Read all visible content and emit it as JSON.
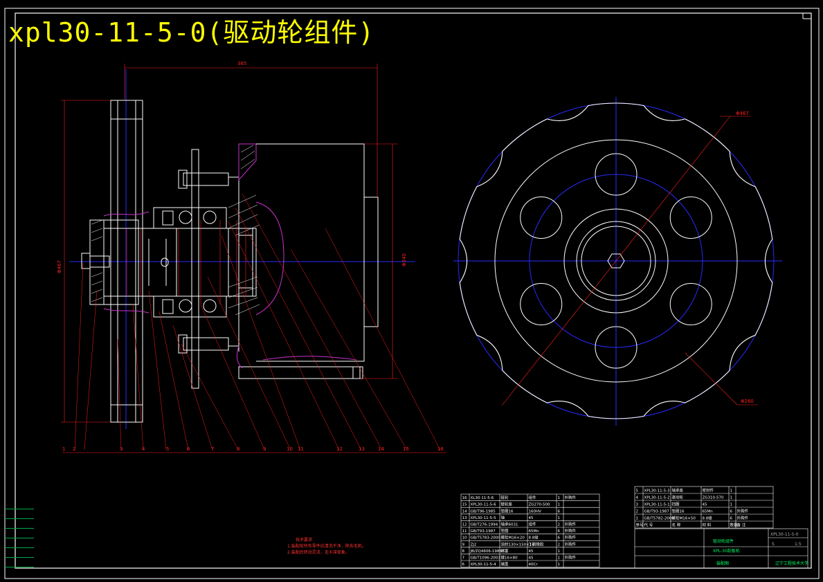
{
  "drawing": {
    "title": "xpl30-11-5-0(驱动轮组件)",
    "dimensions": {
      "overall_width": "365",
      "diameter_left": "Φ467",
      "diameter_right": "Φ340",
      "wheel_outer": "Φ467",
      "pitch_circle": "Φ260"
    },
    "balloons": [
      "1",
      "2",
      "3",
      "4",
      "5",
      "6",
      "7",
      "8",
      "9",
      "10",
      "11",
      "12",
      "13",
      "14",
      "15",
      "16"
    ],
    "tech_notes": [
      "技术要求",
      "1.装配前所有零件应清洗干净，除去毛刺。",
      "2.装配后转动灵活，无卡滞现象。"
    ],
    "left_strip": [
      "",
      "",
      "",
      "",
      "",
      "",
      "",
      "",
      ""
    ]
  },
  "bom_left": [
    {
      "no": "16",
      "code": "XL30-11-5-6",
      "name": "链轮",
      "qty": "1",
      "material": "组件",
      "note": "外购件"
    },
    {
      "no": "15",
      "code": "XPL30-11-5-6",
      "name": "链轮座",
      "qty": "1",
      "material": "ZG270-500",
      "note": ""
    },
    {
      "no": "14",
      "code": "GB/T96-1985",
      "name": "垫圈16",
      "qty": "6",
      "material": "160HV",
      "note": ""
    },
    {
      "no": "13",
      "code": "XPL30-11-5-5",
      "name": "轴",
      "qty": "1",
      "material": "45",
      "note": ""
    },
    {
      "no": "12",
      "code": "GB/T276-1994",
      "name": "轴承6031",
      "qty": "2",
      "material": "组件",
      "note": "外购件"
    },
    {
      "no": "11",
      "code": "GB/T93-1987",
      "name": "垫圈",
      "qty": "6",
      "material": "65Mn",
      "note": "外购件"
    },
    {
      "no": "10",
      "code": "GB/T5783-2000",
      "name": "螺栓M16×20",
      "qty": "6",
      "material": "8.8级",
      "note": "外购件"
    },
    {
      "no": "9",
      "code": "ZJ2",
      "name": "油封130×150×14",
      "qty": "2",
      "material": "丁腈橡胶",
      "note": "外购件"
    },
    {
      "no": "8",
      "code": "JB/ZQ4606-1986",
      "name": "螺塞",
      "qty": "1",
      "material": "45",
      "note": ""
    },
    {
      "no": "7",
      "code": "GB/T1096-2003",
      "name": "键16×80",
      "qty": "1",
      "material": "45",
      "note": "外购件"
    },
    {
      "no": "6",
      "code": "XPL30-11-5-4",
      "name": "端盖",
      "qty": "1",
      "material": "40Cr",
      "note": ""
    }
  ],
  "bom_right": [
    {
      "no": "5",
      "code": "XPL30-11-5-3",
      "name": "轴承座",
      "qty": "1",
      "material": "密封件",
      "note": ""
    },
    {
      "no": "4",
      "code": "XPL30-11-5-2",
      "name": "驱动轮",
      "qty": "1",
      "material": "ZG310-570",
      "note": ""
    },
    {
      "no": "3",
      "code": "XPL30-11-5-1",
      "name": "挡圈",
      "qty": "1",
      "material": "45",
      "note": ""
    },
    {
      "no": "2",
      "code": "GB/T93-1987",
      "name": "垫圈16",
      "qty": "6",
      "material": "65Mn",
      "note": "外购件"
    },
    {
      "no": "1",
      "code": "GB/T5782-2000",
      "name": "螺栓M16×50",
      "qty": "6",
      "material": "8.8级",
      "note": "外购件"
    }
  ],
  "bom_header": {
    "no": "序号",
    "code": "代 号",
    "name": "名 称",
    "qty": "数量",
    "material": "材 料",
    "weight": "重量",
    "note": "备 注"
  },
  "title_block": {
    "part_name": "驱动轮组件",
    "project": "XPL-30刮板机",
    "drawing_no": "XPL30-11-5-0",
    "scale": "1:5",
    "school": "辽宁工程技术大学",
    "sheet_label": "S",
    "assembly": "装配图"
  },
  "colors": {
    "bg": "#000000",
    "line": "#ffffff",
    "center": "#2a2aff",
    "dim": "#ff2020",
    "section": "#cc33cc",
    "title": "#ffff00",
    "frame": "#ffffff",
    "table_text": "#ffffff"
  }
}
